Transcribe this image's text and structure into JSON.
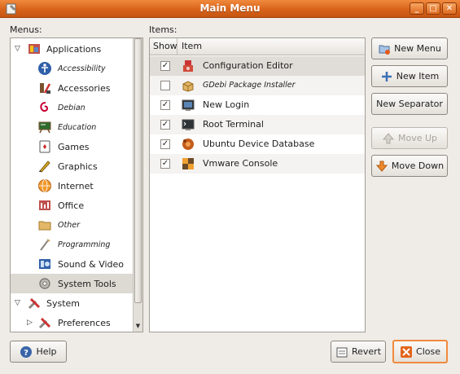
{
  "window": {
    "title": "Main Menu",
    "controls": [
      "minimize",
      "maximize",
      "close"
    ]
  },
  "menus_label": "Menus:",
  "items_label": "Items:",
  "tree": [
    {
      "label": "Applications",
      "level": 0,
      "expanded": true,
      "italic": false,
      "icon": "applications-icon"
    },
    {
      "label": "Accessibility",
      "level": 1,
      "italic": true,
      "icon": "accessibility-icon"
    },
    {
      "label": "Accessories",
      "level": 1,
      "italic": false,
      "icon": "accessories-icon"
    },
    {
      "label": "Debian",
      "level": 1,
      "italic": true,
      "icon": "debian-icon"
    },
    {
      "label": "Education",
      "level": 1,
      "italic": true,
      "icon": "education-icon"
    },
    {
      "label": "Games",
      "level": 1,
      "italic": false,
      "icon": "games-icon"
    },
    {
      "label": "Graphics",
      "level": 1,
      "italic": false,
      "icon": "graphics-icon"
    },
    {
      "label": "Internet",
      "level": 1,
      "italic": false,
      "icon": "internet-icon"
    },
    {
      "label": "Office",
      "level": 1,
      "italic": false,
      "icon": "office-icon"
    },
    {
      "label": "Other",
      "level": 1,
      "italic": true,
      "icon": "other-folder-icon"
    },
    {
      "label": "Programming",
      "level": 1,
      "italic": true,
      "icon": "programming-icon"
    },
    {
      "label": "Sound & Video",
      "level": 1,
      "italic": false,
      "icon": "sound-video-icon"
    },
    {
      "label": "System Tools",
      "level": 1,
      "italic": false,
      "selected": true,
      "icon": "system-tools-icon"
    },
    {
      "label": "System",
      "level": 0,
      "expanded": true,
      "italic": false,
      "icon": "system-icon"
    },
    {
      "label": "Preferences",
      "level": 1,
      "expanded": false,
      "italic": false,
      "icon": "preferences-icon"
    }
  ],
  "items_columns": [
    "Show",
    "Item"
  ],
  "items": [
    {
      "label": "Configuration Editor",
      "checked": true,
      "italic": false,
      "selected": true,
      "icon": "configuration-editor-icon"
    },
    {
      "label": "GDebi Package Installer",
      "checked": false,
      "italic": true,
      "icon": "package-installer-icon"
    },
    {
      "label": "New Login",
      "checked": true,
      "italic": false,
      "icon": "new-login-icon"
    },
    {
      "label": "Root Terminal",
      "checked": true,
      "italic": false,
      "icon": "terminal-icon"
    },
    {
      "label": "Ubuntu Device Database",
      "checked": true,
      "italic": false,
      "icon": "device-database-icon"
    },
    {
      "label": "Vmware Console",
      "checked": true,
      "italic": false,
      "icon": "vmware-icon"
    }
  ],
  "buttons": {
    "new_menu": "New Menu",
    "new_item": "New Item",
    "new_separator": "New Separator",
    "move_up": "Move Up",
    "move_down": "Move Down",
    "help": "Help",
    "revert": "Revert",
    "close": "Close"
  },
  "colors": {
    "titlebar": "#d8631a",
    "selection": "#ddd9d3",
    "accent": "#f08a3d"
  }
}
